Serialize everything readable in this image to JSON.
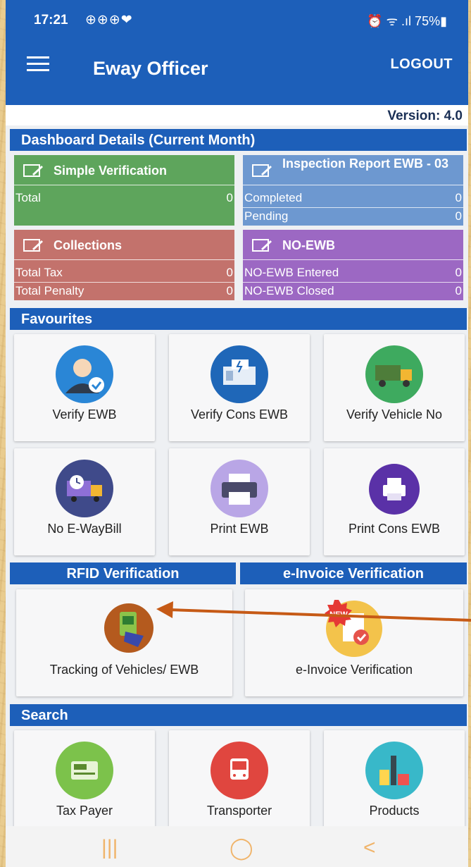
{
  "status_bar": {
    "time": "17:21",
    "left_icons": "⊕⊕⊕❤",
    "right_status": "⏰ ᯤ .ıl 75%▮"
  },
  "app_bar": {
    "title": "Eway Officer",
    "logout_label": "LOGOUT"
  },
  "version": "Version: 4.0",
  "dashboard": {
    "header": "Dashboard Details (Current Month)",
    "simple_verification": {
      "title": "Simple Verification",
      "rows": [
        {
          "label": "Total",
          "value": "0"
        }
      ]
    },
    "inspection_report": {
      "title": "Inspection Report EWB - 03",
      "rows": [
        {
          "label": "Completed",
          "value": "0"
        },
        {
          "label": "Pending",
          "value": "0"
        }
      ]
    },
    "collections": {
      "title": "Collections",
      "rows": [
        {
          "label": "Total Tax",
          "value": "0"
        },
        {
          "label": "Total Penalty",
          "value": "0"
        }
      ]
    },
    "no_ewb": {
      "title": "NO-EWB",
      "rows": [
        {
          "label": "NO-EWB Entered",
          "value": "0"
        },
        {
          "label": "NO-EWB Closed",
          "value": "0"
        }
      ]
    }
  },
  "favourites": {
    "header": "Favourites",
    "items": [
      {
        "label": "Verify EWB",
        "icon": "user-check-icon",
        "color": "#2a86d6"
      },
      {
        "label": "Verify Cons EWB",
        "icon": "generator-icon",
        "color": "#1f67b8"
      },
      {
        "label": "Verify Vehicle No",
        "icon": "truck-icon",
        "color": "#3eaa5f"
      },
      {
        "label": "No E-WayBill",
        "icon": "delivery-truck-clock-icon",
        "color": "#3f4a8a"
      },
      {
        "label": "Print EWB",
        "icon": "printer-icon",
        "color": "#b9a6e6"
      },
      {
        "label": "Print Cons EWB",
        "icon": "printer-icon",
        "color": "#5a31a7"
      }
    ]
  },
  "rfid": {
    "header": "RFID Verification",
    "item_label": "Tracking of Vehicles/ EWB",
    "icon": "rfid-card-icon",
    "color": "#b45a1e"
  },
  "einvoice": {
    "header": "e-Invoice Verification",
    "item_label": "e-Invoice Verification",
    "badge": "NEW",
    "icon": "invoice-check-icon",
    "color": "#f3c34b"
  },
  "search": {
    "header": "Search",
    "items": [
      {
        "label": "Tax Payer",
        "icon": "tax-card-icon",
        "color": "#7cc24b"
      },
      {
        "label": "Transporter",
        "icon": "bus-icon",
        "color": "#e0463f"
      },
      {
        "label": "Products",
        "icon": "products-icon",
        "color": "#38b8c9"
      }
    ]
  },
  "nav": {
    "recent": "|||",
    "home": "◯",
    "back": "<"
  },
  "accent_color": "#1d5fb9",
  "annotation_arrow_color": "#c65a16"
}
